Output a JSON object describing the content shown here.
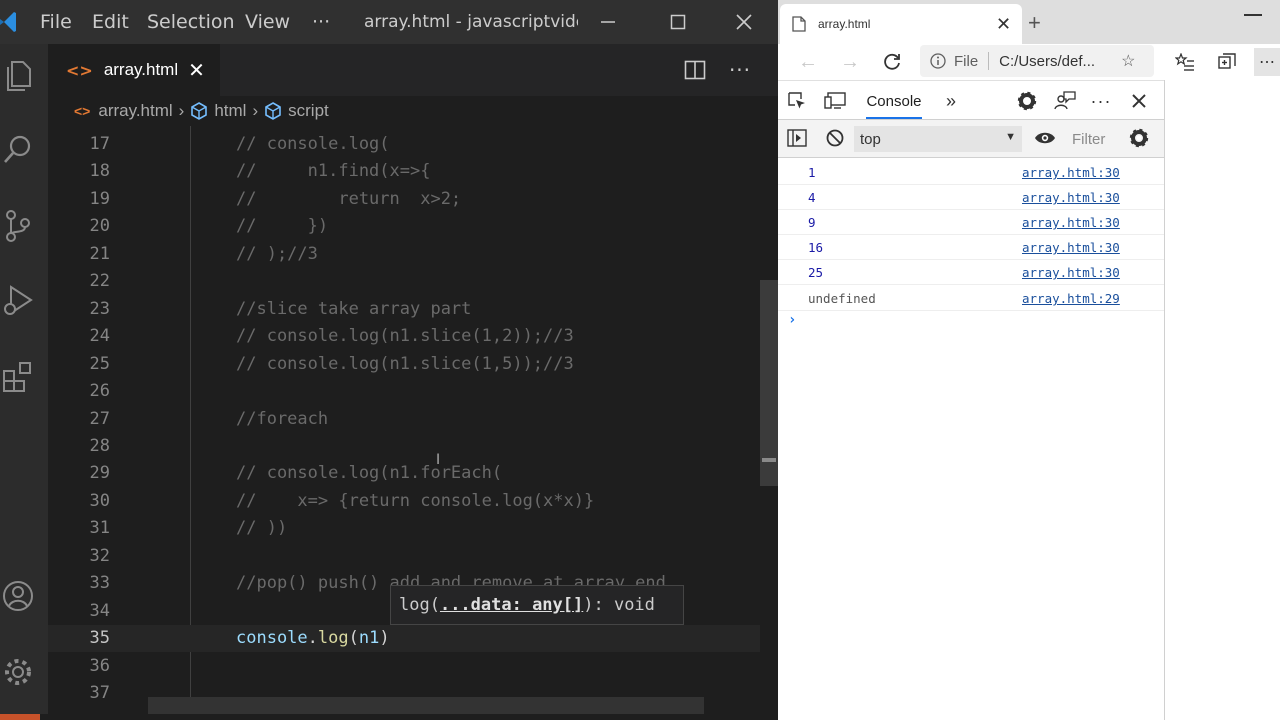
{
  "vscode": {
    "menu": [
      "File",
      "Edit",
      "Selection",
      "View",
      "···"
    ],
    "window_title": "array.html - javascriptvide...",
    "tab": {
      "label": "array.html"
    },
    "breadcrumb": [
      "array.html",
      "html",
      "script"
    ],
    "lines": [
      {
        "n": "17",
        "code": "// console.log("
      },
      {
        "n": "18",
        "code": "//     n1.find(x=>{"
      },
      {
        "n": "19",
        "code": "//        return  x>2;"
      },
      {
        "n": "20",
        "code": "//     })"
      },
      {
        "n": "21",
        "code": "// );//3"
      },
      {
        "n": "22",
        "code": ""
      },
      {
        "n": "23",
        "code": "//slice take array part"
      },
      {
        "n": "24",
        "code": "// console.log(n1.slice(1,2));//3"
      },
      {
        "n": "25",
        "code": "// console.log(n1.slice(1,5));//3"
      },
      {
        "n": "26",
        "code": ""
      },
      {
        "n": "27",
        "code": "//foreach"
      },
      {
        "n": "28",
        "code": ""
      },
      {
        "n": "29",
        "code": "// console.log(n1.forEach("
      },
      {
        "n": "30",
        "code": "//    x=> {return console.log(x*x)}"
      },
      {
        "n": "31",
        "code": "// ))"
      },
      {
        "n": "32",
        "code": ""
      },
      {
        "n": "33",
        "code": "//pop() push() add and remove at array end"
      },
      {
        "n": "34",
        "code": ""
      },
      {
        "n": "35",
        "code": ""
      },
      {
        "n": "36",
        "code": ""
      },
      {
        "n": "37",
        "code": ""
      }
    ],
    "current_line": {
      "console": "console",
      "dot": ".",
      "log": "log",
      "open": "(",
      "arg": "n1",
      "close": ")"
    },
    "tooltip": {
      "prefix": "log(",
      "param": "...data: any[]",
      "suffix": "): void"
    }
  },
  "browser": {
    "tab_title": "array.html",
    "address": {
      "scheme_label": "File",
      "url": "C:/Users/def..."
    },
    "devtools": {
      "active_tab": "Console",
      "context": "top",
      "filter_placeholder": "Filter"
    },
    "console_logs": [
      {
        "value": "1",
        "type": "number",
        "source": "array.html:30"
      },
      {
        "value": "4",
        "type": "number",
        "source": "array.html:30"
      },
      {
        "value": "9",
        "type": "number",
        "source": "array.html:30"
      },
      {
        "value": "16",
        "type": "number",
        "source": "array.html:30"
      },
      {
        "value": "25",
        "type": "number",
        "source": "array.html:30"
      },
      {
        "value": "undefined",
        "type": "undefined",
        "source": "array.html:29"
      }
    ],
    "prompt": "›"
  },
  "colors": {
    "vscode_bg": "#1e1e1e",
    "comment": "#6a6a6a",
    "html_icon": "#e37933",
    "console_number": "#1a1aa6",
    "link": "#1a4f9c",
    "accent": "#1a73e8"
  }
}
